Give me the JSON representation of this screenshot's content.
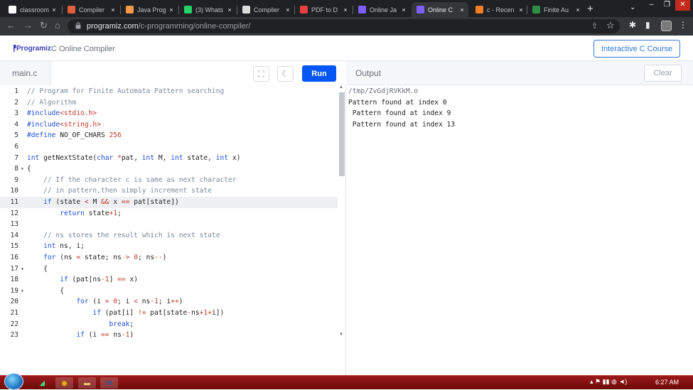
{
  "browser": {
    "tabs": [
      {
        "title": "classroom",
        "favicon": "google-icon",
        "color": "#ffffff",
        "active": false
      },
      {
        "title": "Compiler",
        "favicon": "compiler-icon",
        "color": "#e25f3b",
        "active": false
      },
      {
        "title": "Java Prog",
        "favicon": "code-icon",
        "color": "#f2994a",
        "active": false
      },
      {
        "title": "(3) Whats",
        "favicon": "whatsapp-icon",
        "color": "#25d366",
        "active": false
      },
      {
        "title": "Compiler",
        "favicon": "compiler-icon",
        "color": "#dddddd",
        "active": false
      },
      {
        "title": "PDF to D",
        "favicon": "pdf-icon",
        "color": "#e5403b",
        "active": false
      },
      {
        "title": "Online Ja",
        "favicon": "programiz-icon",
        "color": "#7d5fff",
        "active": false
      },
      {
        "title": "Online C",
        "favicon": "programiz-icon",
        "color": "#7d5fff",
        "active": true
      },
      {
        "title": "c - Recen",
        "favicon": "stackoverflow-icon",
        "color": "#f48024",
        "active": false
      },
      {
        "title": "Finite Au",
        "favicon": "geeksforgeeks-icon",
        "color": "#2f8d46",
        "active": false
      }
    ],
    "new_tab_label": "+",
    "url_host": "programiz.com",
    "url_path": "/c-programming/online-compiler/"
  },
  "site": {
    "logo_text": "Programiz",
    "title": "C Online Compiler",
    "course_button": "Interactive C Course"
  },
  "editor": {
    "file_name": "main.c",
    "run_label": "Run",
    "active_line": 11,
    "lines": [
      {
        "n": "1",
        "fold": "",
        "tokens": [
          {
            "t": "// Program for Finite Automata Pattern searching",
            "c": "cm"
          }
        ]
      },
      {
        "n": "2",
        "fold": "",
        "tokens": [
          {
            "t": "// Algorithm",
            "c": "cm"
          }
        ]
      },
      {
        "n": "3",
        "fold": "",
        "tokens": [
          {
            "t": "#include",
            "c": "kw"
          },
          {
            "t": "<stdio.h>",
            "c": "st"
          }
        ]
      },
      {
        "n": "4",
        "fold": "",
        "tokens": [
          {
            "t": "#include",
            "c": "kw"
          },
          {
            "t": "<string.h>",
            "c": "st"
          }
        ]
      },
      {
        "n": "5",
        "fold": "",
        "tokens": [
          {
            "t": "#define",
            "c": "kw"
          },
          {
            "t": " NO_OF_CHARS ",
            "c": ""
          },
          {
            "t": "256",
            "c": "nm"
          }
        ]
      },
      {
        "n": "6",
        "fold": "",
        "tokens": []
      },
      {
        "n": "7",
        "fold": "",
        "tokens": [
          {
            "t": "int",
            "c": "kw"
          },
          {
            "t": " getNextState(",
            "c": ""
          },
          {
            "t": "char",
            "c": "kw"
          },
          {
            "t": " ",
            "c": ""
          },
          {
            "t": "*",
            "c": "op"
          },
          {
            "t": "pat, ",
            "c": ""
          },
          {
            "t": "int",
            "c": "kw"
          },
          {
            "t": " M, ",
            "c": ""
          },
          {
            "t": "int",
            "c": "kw"
          },
          {
            "t": " state, ",
            "c": ""
          },
          {
            "t": "int",
            "c": "kw"
          },
          {
            "t": " x)",
            "c": ""
          }
        ]
      },
      {
        "n": "8",
        "fold": "▾",
        "tokens": [
          {
            "t": "{",
            "c": ""
          }
        ]
      },
      {
        "n": "9",
        "fold": "",
        "tokens": [
          {
            "t": "    // If the character c is same as next character",
            "c": "cm"
          }
        ]
      },
      {
        "n": "10",
        "fold": "",
        "tokens": [
          {
            "t": "    // in pattern,then simply increment state",
            "c": "cm"
          }
        ]
      },
      {
        "n": "11",
        "fold": "",
        "tokens": [
          {
            "t": "    ",
            "c": ""
          },
          {
            "t": "if",
            "c": "kw"
          },
          {
            "t": " (state ",
            "c": ""
          },
          {
            "t": "<",
            "c": "op"
          },
          {
            "t": " M ",
            "c": ""
          },
          {
            "t": "&&",
            "c": "op"
          },
          {
            "t": " x ",
            "c": ""
          },
          {
            "t": "==",
            "c": "op"
          },
          {
            "t": " pat[state])",
            "c": ""
          }
        ]
      },
      {
        "n": "12",
        "fold": "",
        "tokens": [
          {
            "t": "        ",
            "c": ""
          },
          {
            "t": "return",
            "c": "kw"
          },
          {
            "t": " state",
            "c": ""
          },
          {
            "t": "+",
            "c": "op"
          },
          {
            "t": "1",
            "c": "nm"
          },
          {
            "t": ";",
            "c": ""
          }
        ]
      },
      {
        "n": "13",
        "fold": "",
        "tokens": []
      },
      {
        "n": "14",
        "fold": "",
        "tokens": [
          {
            "t": "    // ns stores the result which is next state",
            "c": "cm"
          }
        ]
      },
      {
        "n": "15",
        "fold": "",
        "tokens": [
          {
            "t": "    ",
            "c": ""
          },
          {
            "t": "int",
            "c": "kw"
          },
          {
            "t": " ns, i;",
            "c": ""
          }
        ]
      },
      {
        "n": "16",
        "fold": "",
        "tokens": [
          {
            "t": "    ",
            "c": ""
          },
          {
            "t": "for",
            "c": "kw"
          },
          {
            "t": " (ns ",
            "c": ""
          },
          {
            "t": "=",
            "c": "op"
          },
          {
            "t": " state; ns ",
            "c": ""
          },
          {
            "t": ">",
            "c": "op"
          },
          {
            "t": " ",
            "c": ""
          },
          {
            "t": "0",
            "c": "nm"
          },
          {
            "t": "; ns",
            "c": ""
          },
          {
            "t": "--",
            "c": "op"
          },
          {
            "t": ")",
            "c": ""
          }
        ]
      },
      {
        "n": "17",
        "fold": "▾",
        "tokens": [
          {
            "t": "    {",
            "c": ""
          }
        ]
      },
      {
        "n": "18",
        "fold": "",
        "tokens": [
          {
            "t": "        ",
            "c": ""
          },
          {
            "t": "if",
            "c": "kw"
          },
          {
            "t": " (pat[ns",
            "c": ""
          },
          {
            "t": "-",
            "c": "op"
          },
          {
            "t": "1",
            "c": "nm"
          },
          {
            "t": "] ",
            "c": ""
          },
          {
            "t": "==",
            "c": "op"
          },
          {
            "t": " x)",
            "c": ""
          }
        ]
      },
      {
        "n": "19",
        "fold": "▾",
        "tokens": [
          {
            "t": "        {",
            "c": ""
          }
        ]
      },
      {
        "n": "20",
        "fold": "",
        "tokens": [
          {
            "t": "            ",
            "c": ""
          },
          {
            "t": "for",
            "c": "kw"
          },
          {
            "t": " (i ",
            "c": ""
          },
          {
            "t": "=",
            "c": "op"
          },
          {
            "t": " ",
            "c": ""
          },
          {
            "t": "0",
            "c": "nm"
          },
          {
            "t": "; i ",
            "c": ""
          },
          {
            "t": "<",
            "c": "op"
          },
          {
            "t": " ns",
            "c": ""
          },
          {
            "t": "-",
            "c": "op"
          },
          {
            "t": "1",
            "c": "nm"
          },
          {
            "t": "; i",
            "c": ""
          },
          {
            "t": "++",
            "c": "op"
          },
          {
            "t": ")",
            "c": ""
          }
        ]
      },
      {
        "n": "21",
        "fold": "",
        "tokens": [
          {
            "t": "                ",
            "c": ""
          },
          {
            "t": "if",
            "c": "kw"
          },
          {
            "t": " (pat[i] ",
            "c": ""
          },
          {
            "t": "!=",
            "c": "op"
          },
          {
            "t": " pat[state",
            "c": ""
          },
          {
            "t": "-",
            "c": "op"
          },
          {
            "t": "ns",
            "c": ""
          },
          {
            "t": "+",
            "c": "op"
          },
          {
            "t": "1",
            "c": "nm"
          },
          {
            "t": "+",
            "c": "op"
          },
          {
            "t": "i])",
            "c": ""
          }
        ]
      },
      {
        "n": "22",
        "fold": "",
        "tokens": [
          {
            "t": "                    ",
            "c": ""
          },
          {
            "t": "break",
            "c": "kw"
          },
          {
            "t": ";",
            "c": ""
          }
        ]
      },
      {
        "n": "23",
        "fold": "",
        "tokens": [
          {
            "t": "            ",
            "c": ""
          },
          {
            "t": "if",
            "c": "kw"
          },
          {
            "t": " (i ",
            "c": ""
          },
          {
            "t": "==",
            "c": "op"
          },
          {
            "t": " ns",
            "c": ""
          },
          {
            "t": "-",
            "c": "op"
          },
          {
            "t": "1",
            "c": "nm"
          },
          {
            "t": ")",
            "c": ""
          }
        ]
      }
    ]
  },
  "output": {
    "title": "Output",
    "clear_label": "Clear",
    "lines": [
      "/tmp/ZvGdjRVKkM.o",
      "Pattern found at index 0",
      " Pattern found at index 9",
      " Pattern found at index 13"
    ]
  },
  "taskbar": {
    "clock": "6:27 AM",
    "apps": [
      {
        "name": "android-studio-icon",
        "glyph": "◢",
        "color": "#3ddc84"
      },
      {
        "name": "chrome-icon",
        "glyph": "◉",
        "color": "#e8b400"
      },
      {
        "name": "file-explorer-icon",
        "glyph": "▬",
        "color": "#f3d27a"
      },
      {
        "name": "word-icon",
        "glyph": "W",
        "color": "#2b579a"
      }
    ]
  },
  "colors": {
    "accent": "#0556f3",
    "brand": "#3b3fb1",
    "keyword": "#1f50d8",
    "comment": "#7a8b9c",
    "string": "#c0392b"
  }
}
